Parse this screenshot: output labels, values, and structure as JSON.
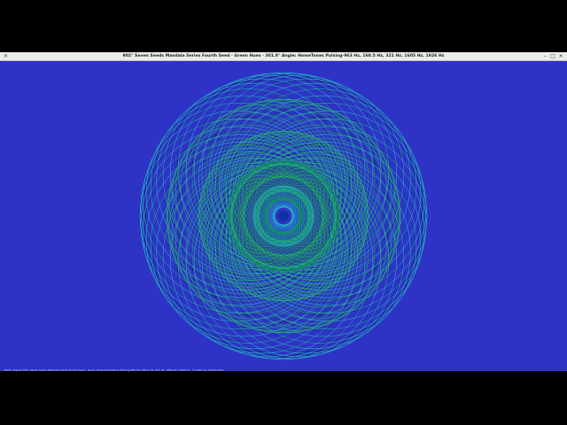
{
  "window": {
    "title": "902° Seven Seeds Mandala Series Fourth Seed · Green Hues · 301.0° Angle: HomeTones Pulsing·963 Hz, 160.5 Hz, 321 Hz, 1605 Hz, 1926 Hz",
    "app_icon": "x-icon",
    "controls": {
      "minimize": "–",
      "maximize": "□",
      "close": "×"
    }
  },
  "canvas": {
    "background": "#2e33c6",
    "caption": "2022° degree 902° Seven Seeds Mandala Series Fourth Seed · Green Hues·HomeTones Pulsing·963 Hz, 160.5 Hz, 321 Hz, 1605 Hz, 1926 Hz · © 2022 by artist/author",
    "colors": {
      "outer": "#1fd8c4",
      "mid": "#22c75a",
      "inner": "#0a8a2a",
      "dark": "#0a1a40",
      "core": "#1030a0"
    }
  }
}
